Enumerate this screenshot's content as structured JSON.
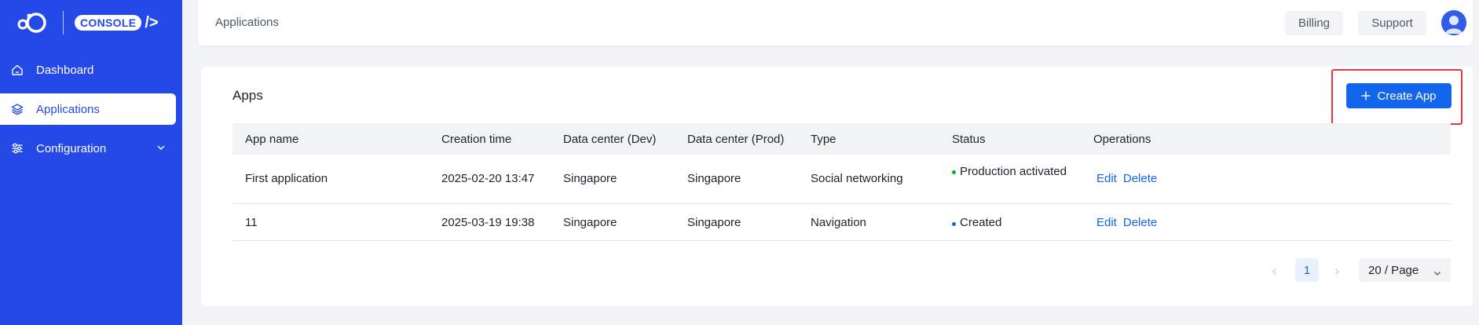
{
  "sidebar": {
    "logo_badge": "CONSOLE",
    "logo_slash": "/>",
    "items": [
      {
        "label": "Dashboard",
        "icon": "home-icon"
      },
      {
        "label": "Applications",
        "icon": "layers-icon"
      },
      {
        "label": "Configuration",
        "icon": "sliders-icon"
      }
    ]
  },
  "header": {
    "breadcrumb": "Applications",
    "billing_label": "Billing",
    "support_label": "Support"
  },
  "main": {
    "title": "Apps",
    "create_label": "Create App",
    "table": {
      "columns": [
        "App name",
        "Creation time",
        "Data center (Dev)",
        "Data center (Prod)",
        "Type",
        "Status",
        "Operations"
      ],
      "rows": [
        {
          "app_name": "First application",
          "creation_time": "2025-02-20 13:47",
          "dc_dev": "Singapore",
          "dc_prod": "Singapore",
          "type": "Social networking",
          "status": "Production activated",
          "status_color": "#00b42a",
          "edit": "Edit",
          "delete": "Delete"
        },
        {
          "app_name": "11",
          "creation_time": "2025-03-19 19:38",
          "dc_dev": "Singapore",
          "dc_prod": "Singapore",
          "type": "Navigation",
          "status": "Created",
          "status_color": "#1366ec",
          "edit": "Edit",
          "delete": "Delete"
        }
      ]
    },
    "pagination": {
      "current_page": "1",
      "page_size": "20 / Page"
    }
  },
  "colors": {
    "sidebar": "#2449e6",
    "primary": "#1366ec",
    "highlight": "#e5383b"
  }
}
